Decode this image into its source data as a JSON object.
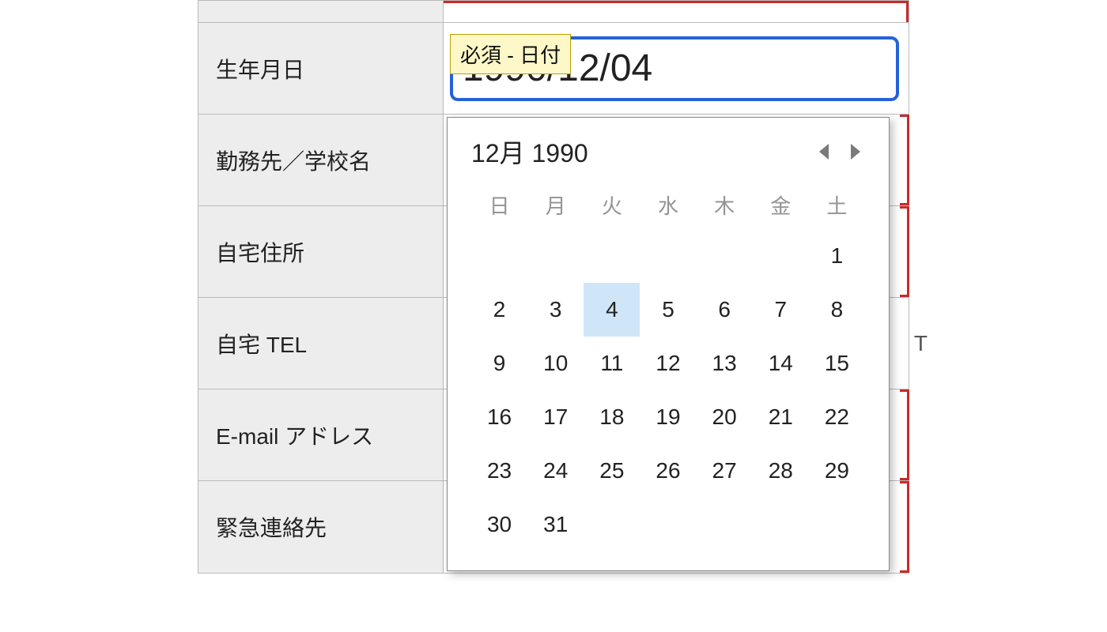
{
  "validation": {
    "badge": "必須 - 日付"
  },
  "form": {
    "rows": [
      {
        "label": "生年月日",
        "value": "1990/12/04"
      },
      {
        "label": "勤務先／学校名"
      },
      {
        "label": "自宅住所"
      },
      {
        "label": "自宅 TEL",
        "hint": "T"
      },
      {
        "label": "E-mail アドレス"
      },
      {
        "label": "緊急連絡先"
      }
    ]
  },
  "datepicker": {
    "title": "12月 1990",
    "weekdays": [
      "日",
      "月",
      "火",
      "水",
      "木",
      "金",
      "土"
    ],
    "first_weekday_index": 6,
    "days_in_month": 31,
    "selected_day": 4
  }
}
